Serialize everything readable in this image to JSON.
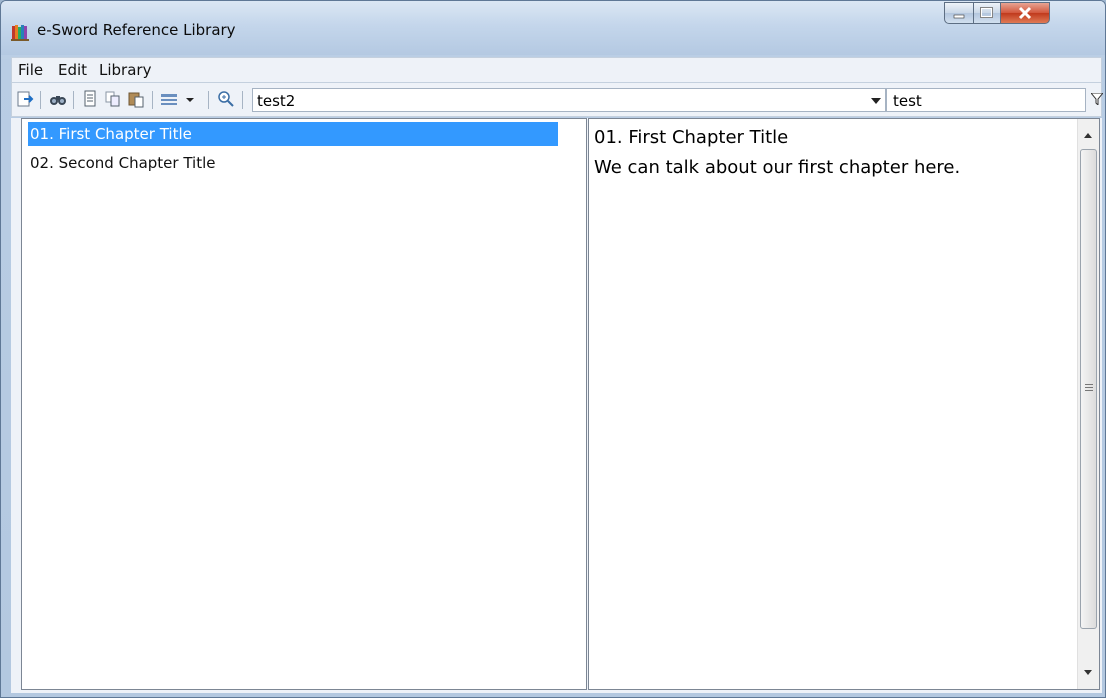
{
  "window": {
    "title": "e-Sword Reference Library",
    "icons": [
      "app-books-icon",
      "minimize-icon",
      "maximize-icon",
      "close-icon"
    ]
  },
  "menu": {
    "items": [
      {
        "label": "File"
      },
      {
        "label": "Edit"
      },
      {
        "label": "Library"
      }
    ]
  },
  "toolbar": {
    "icons": [
      "export-icon",
      "find-icon",
      "document-icon",
      "copy-icon",
      "paste-icon",
      "edit-dropdown-icon",
      "zoom-icon"
    ],
    "topic_select": {
      "value": "test2"
    },
    "search": {
      "value": "test"
    },
    "filter_icon": "filter-icon"
  },
  "list": {
    "items": [
      {
        "label": "01. First Chapter Title",
        "selected": true
      },
      {
        "label": "02. Second Chapter Title",
        "selected": false
      }
    ]
  },
  "content": {
    "title": "01. First Chapter Title",
    "body": "We can talk about our first chapter here."
  }
}
